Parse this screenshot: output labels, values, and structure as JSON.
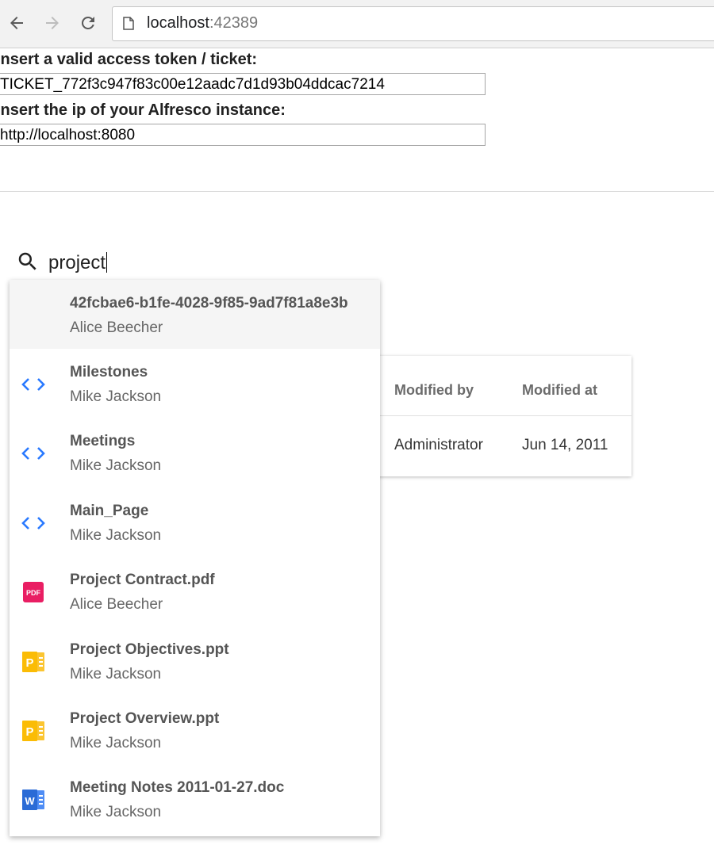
{
  "browser": {
    "url_host": "localhost",
    "url_port": ":42389"
  },
  "form": {
    "token_label": "Insert a valid access token / ticket:",
    "token_value": "TICKET_772f3c947f83c00e12aadc7d1d93b04ddcac7214",
    "ip_label": "Insert the ip of your Alfresco instance:",
    "ip_value": "http://localhost:8080"
  },
  "search": {
    "value": "project"
  },
  "table": {
    "headers": [
      "Modified by",
      "Modified at"
    ],
    "row": [
      "Administrator",
      "Jun 14, 2011"
    ]
  },
  "suggestions": [
    {
      "title": "42fcbae6-b1fe-4028-9f85-9ad7f81a8e3b",
      "author": "Alice Beecher",
      "icon": "none"
    },
    {
      "title": "Milestones",
      "author": "Mike Jackson",
      "icon": "code-icon"
    },
    {
      "title": "Meetings",
      "author": "Mike Jackson",
      "icon": "code-icon"
    },
    {
      "title": "Main_Page",
      "author": "Mike Jackson",
      "icon": "code-icon"
    },
    {
      "title": "Project Contract.pdf",
      "author": "Alice Beecher",
      "icon": "pdf-icon"
    },
    {
      "title": "Project Objectives.ppt",
      "author": "Mike Jackson",
      "icon": "powerpoint-icon"
    },
    {
      "title": "Project Overview.ppt",
      "author": "Mike Jackson",
      "icon": "powerpoint-icon"
    },
    {
      "title": "Meeting Notes 2011-01-27.doc",
      "author": "Mike Jackson",
      "icon": "word-icon"
    }
  ],
  "colors": {
    "code_icon": "#2979ff",
    "pdf_icon": "#e91e63",
    "ppt_icon": "#fbbc05",
    "word_icon": "#2a6bd6",
    "search_underline": "#3f51b5"
  },
  "icon_text": {
    "pdf": "PDF",
    "ppt": "P",
    "word": "W"
  }
}
